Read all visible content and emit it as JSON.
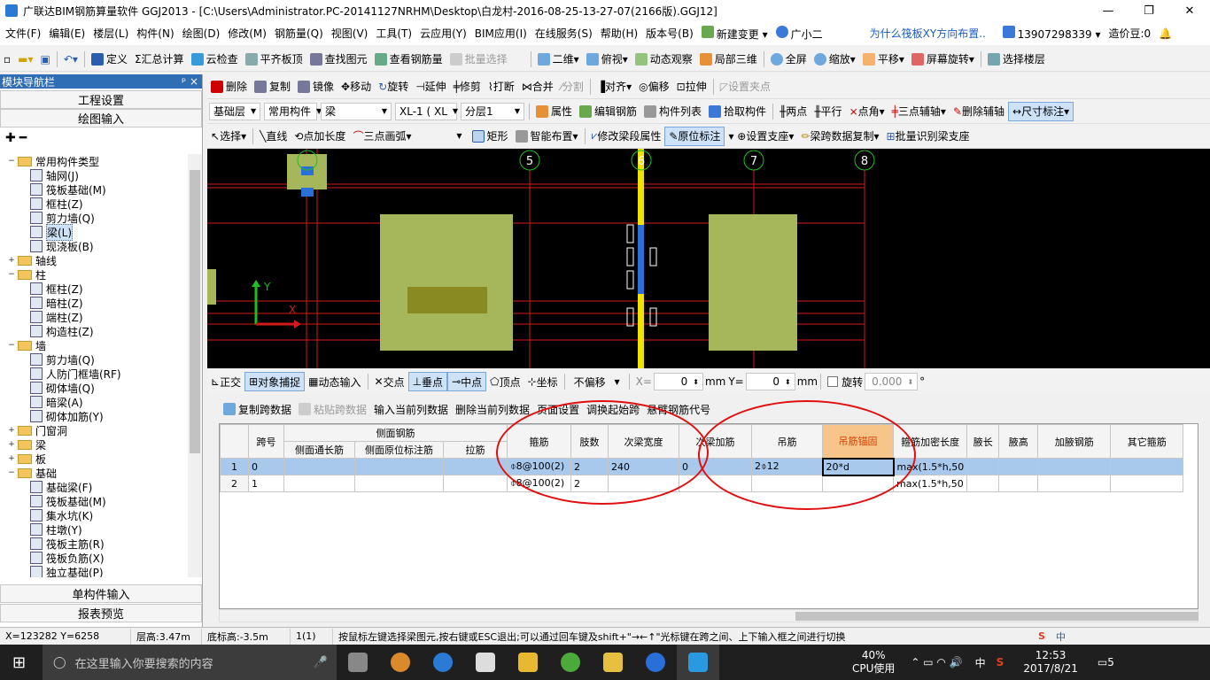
{
  "title": "广联达BIM钢筋算量软件 GGJ2013 - [C:\\Users\\Administrator.PC-20141127NRHM\\Desktop\\白龙村-2016-08-25-13-27-07(2166版).GGJ12]",
  "window_buttons": {
    "minimize": "—",
    "restore": "❐",
    "close": "✕"
  },
  "menu": [
    "文件(F)",
    "编辑(E)",
    "楼层(L)",
    "构件(N)",
    "绘图(D)",
    "修改(M)",
    "钢筋量(Q)",
    "视图(V)",
    "工具(T)",
    "云应用(Y)",
    "BIM应用(I)",
    "在线服务(S)",
    "帮助(H)",
    "版本号(B)"
  ],
  "menu_right": {
    "new_change": "新建变更",
    "assistant": "广小二",
    "question": "为什么筏板XY方向布置..",
    "phone": "13907298339",
    "coins": "造价豆:0"
  },
  "toolbar1": {
    "define": "定义",
    "sum": "汇总计算",
    "cloud_check": "云检查",
    "flat_top": "平齐板顶",
    "find": "查找图元",
    "view_rebar": "查看钢筋量",
    "batch_select": "批量选择",
    "view_2d": "二维",
    "top_view": "俯视",
    "dyn_view": "动态观察",
    "local_3d": "局部三维",
    "full": "全屏",
    "zoom": "缩放",
    "pan": "平移",
    "rotate": "屏幕旋转",
    "select_floor": "选择楼层"
  },
  "toolbar2": {
    "delete": "删除",
    "copy": "复制",
    "mirror": "镜像",
    "move": "移动",
    "rotate": "旋转",
    "extend": "延伸",
    "trim": "修剪",
    "break": "打断",
    "merge": "合并",
    "split": "分割",
    "align": "对齐",
    "offset": "偏移",
    "stretch": "拉伸",
    "set_point": "设置夹点"
  },
  "toolbar3": {
    "floor": "基础层",
    "comp_type": "常用构件",
    "beam": "梁",
    "comp": "XL-1 ( XL",
    "layer": "分层1",
    "attr": "属性",
    "edit_rebar": "编辑钢筋",
    "comp_list": "构件列表",
    "pick": "拾取构件",
    "two_point": "两点",
    "parallel": "平行",
    "point_angle": "点角",
    "three_point_axis": "三点辅轴",
    "del_axis": "删除辅轴",
    "dimension": "尺寸标注"
  },
  "toolbar4": {
    "select": "选择",
    "line": "直线",
    "point_len": "点加长度",
    "arc": "三点画弧",
    "rect": "矩形",
    "smart": "智能布置",
    "modify_span": "修改梁段属性",
    "orig_mark": "原位标注",
    "set_support": "设置支座",
    "span_copy": "梁跨数据复制",
    "batch_support": "批量识别梁支座"
  },
  "left_panel": {
    "header": "模块导航栏",
    "pin": "ᵖ ×",
    "section_top": [
      "工程设置",
      "绘图输入"
    ],
    "section_bottom": [
      "单构件输入",
      "报表预览"
    ],
    "tree": [
      {
        "level": 0,
        "toggle": "−",
        "folder": true,
        "label": "常用构件类型"
      },
      {
        "level": 1,
        "label": "轴网(J)"
      },
      {
        "level": 1,
        "label": "筏板基础(M)"
      },
      {
        "level": 1,
        "label": "框柱(Z)"
      },
      {
        "level": 1,
        "label": "剪力墙(Q)"
      },
      {
        "level": 1,
        "label": "梁(L)",
        "selected": true
      },
      {
        "level": 1,
        "label": "现浇板(B)"
      },
      {
        "level": 0,
        "toggle": "+",
        "folder": true,
        "label": "轴线"
      },
      {
        "level": 0,
        "toggle": "−",
        "folder": true,
        "label": "柱"
      },
      {
        "level": 1,
        "label": "框柱(Z)"
      },
      {
        "level": 1,
        "label": "暗柱(Z)"
      },
      {
        "level": 1,
        "label": "端柱(Z)"
      },
      {
        "level": 1,
        "label": "构造柱(Z)"
      },
      {
        "level": 0,
        "toggle": "−",
        "folder": true,
        "label": "墙"
      },
      {
        "level": 1,
        "label": "剪力墙(Q)"
      },
      {
        "level": 1,
        "label": "人防门框墙(RF)"
      },
      {
        "level": 1,
        "label": "砌体墙(Q)"
      },
      {
        "level": 1,
        "label": "暗梁(A)"
      },
      {
        "level": 1,
        "label": "砌体加筋(Y)"
      },
      {
        "level": 0,
        "toggle": "+",
        "folder": true,
        "label": "门窗洞"
      },
      {
        "level": 0,
        "toggle": "+",
        "folder": true,
        "label": "梁"
      },
      {
        "level": 0,
        "toggle": "+",
        "folder": true,
        "label": "板"
      },
      {
        "level": 0,
        "toggle": "−",
        "folder": true,
        "label": "基础"
      },
      {
        "level": 1,
        "label": "基础梁(F)"
      },
      {
        "level": 1,
        "label": "筏板基础(M)"
      },
      {
        "level": 1,
        "label": "集水坑(K)"
      },
      {
        "level": 1,
        "label": "柱墩(Y)"
      },
      {
        "level": 1,
        "label": "筏板主筋(R)"
      },
      {
        "level": 1,
        "label": "筏板负筋(X)"
      },
      {
        "level": 1,
        "label": "独立基础(P)"
      }
    ]
  },
  "canvas": {
    "axis_labels": [
      "5",
      "6",
      "7",
      "8"
    ],
    "y_label": "Y",
    "x_label": "X"
  },
  "snapbar": {
    "ortho": "正交",
    "snap": "对象捕捉",
    "dyn_input": "动态输入",
    "intersect": "交点",
    "perp": "垂点",
    "mid": "中点",
    "vertex": "顶点",
    "coord": "坐标",
    "offset_mode": "不偏移",
    "x_label": "X=",
    "x_val": "0",
    "y_label": "Y=",
    "y_val": "0",
    "unit": "mm",
    "rotate_label": "旋转",
    "rotate_val": "0.000",
    "deg": "°"
  },
  "grid_toolbar": {
    "copy_span": "复制跨数据",
    "paste_span": "粘贴跨数据",
    "input_col": "输入当前列数据",
    "delete_col": "删除当前列数据",
    "page_setup": "页面设置",
    "adjust_start": "调换起始跨",
    "hanging_code": "悬臂钢筋代号"
  },
  "grid": {
    "group_header": "侧面钢筋",
    "headers": [
      "跨号",
      "侧面通长筋",
      "侧面原位标注筋",
      "拉筋",
      "箍筋",
      "肢数",
      "次梁宽度",
      "次梁加筋",
      "吊筋",
      "吊筋锚固",
      "箍筋加密长度",
      "腋长",
      "腋高",
      "加腋钢筋",
      "其它箍筋"
    ],
    "rows": [
      {
        "num": "1",
        "span": "0",
        "c1": "",
        "c2": "",
        "c3": "",
        "stirrup": "⌽8@100(2)",
        "legs": "2",
        "sec_width": "240",
        "sec_add": "0",
        "hang": "2⌽12",
        "hang_anchor": "20*d",
        "dense": "max(1.5*h,50",
        "a1": "",
        "a2": "",
        "a3": "",
        "a4": ""
      },
      {
        "num": "2",
        "span": "1",
        "c1": "",
        "c2": "",
        "c3": "",
        "stirrup": "⌽8@100(2)",
        "legs": "2",
        "sec_width": "",
        "sec_add": "",
        "hang": "",
        "hang_anchor": "",
        "dense": "max(1.5*h,50",
        "a1": "",
        "a2": "",
        "a3": "",
        "a4": ""
      }
    ]
  },
  "status": {
    "coord": "X=123282 Y=6258",
    "floor_h": "层高:3.47m",
    "bottom_h": "底标高:-3.5m",
    "count": "1(1)",
    "hint": "按鼠标左键选择梁图元,按右键或ESC退出;可以通过回车键及shift+\"→←↑\"光标键在跨之间、上下输入框之间进行切换",
    "ime": "中"
  },
  "taskbar": {
    "search": "在这里输入你要搜索的内容",
    "cpu": "40%",
    "cpu_label": "CPU使用",
    "lang": "中",
    "time": "12:53",
    "date": "2017/8/21",
    "notif": "5"
  },
  "colors": {
    "canvas_bg": "#000000",
    "beam_fill": "#a5b75a",
    "axis_red": "#d21a1a",
    "highlight_yellow": "#f2e200",
    "selected_row": "#a9c9ec",
    "annotation_red": "#e01010"
  }
}
